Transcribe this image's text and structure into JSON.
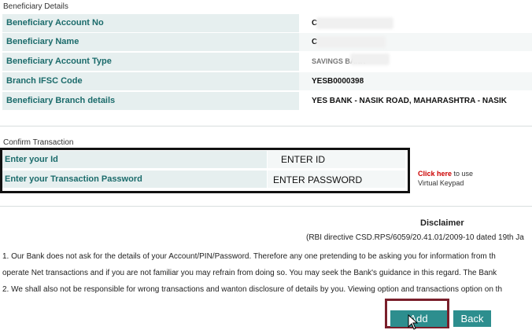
{
  "beneficiary": {
    "section_title": "Beneficiary Details",
    "rows": [
      {
        "label": "Beneficiary Account No",
        "value": "C"
      },
      {
        "label": "Beneficiary Name",
        "value": "C"
      },
      {
        "label": "Beneficiary Account Type",
        "value": "SAVINGS BANK"
      },
      {
        "label": "Branch IFSC Code",
        "value": "YESB0000398"
      },
      {
        "label": "Beneficiary Branch details",
        "value": "YES BANK - NASIK ROAD, MAHARASHTRA - NASIK"
      }
    ]
  },
  "confirm": {
    "section_title": "Confirm Transaction",
    "id_label": "Enter your Id",
    "id_value": "ENTER ID",
    "password_label": "Enter your Transaction Password",
    "password_value": "ENTER PASSWORD",
    "click_here": "Click here",
    "to_use": " to use",
    "virtual_keypad": "Virtual Keypad"
  },
  "disclaimer": {
    "title": "Disclaimer",
    "ref": "(RBI directive CSD.RPS/6059/20.41.01/2009-10 dated 19th Ja",
    "line1": "1. Our Bank does not ask for the details of your Account/PIN/Password. Therefore any one pretending to be asking you for information from th",
    "line2": "operate Net transactions and if you are not familiar you may refrain from doing so. You may seek the Bank's guidance in this regard. The Bank",
    "line3": "2. We shall also not be responsible for wrong transactions and wanton disclosure of details by you. Viewing option and transactions option on th"
  },
  "buttons": {
    "add": "Add",
    "back": "Back"
  },
  "colors": {
    "label_bg": "#e6efef",
    "label_text": "#1b6b6b",
    "button_bg": "#2d8e8e",
    "highlight_box": "#7a1f2b",
    "link_red": "#cc0000"
  }
}
